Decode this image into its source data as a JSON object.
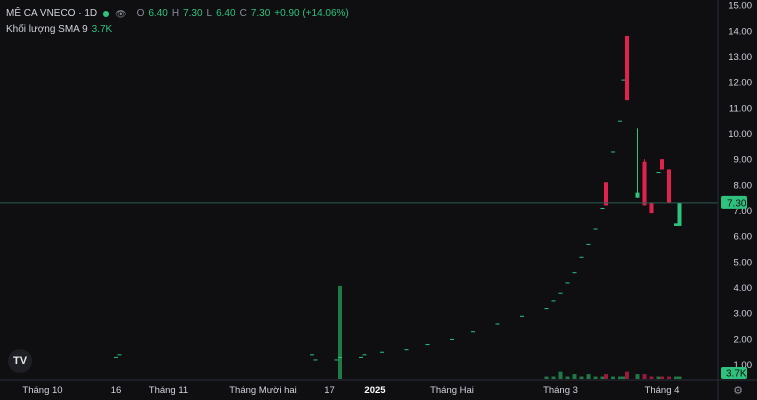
{
  "header": {
    "symbol": "MÊ CA VNECO · 1D",
    "ohlc": {
      "o_label": "O",
      "o": "6.40",
      "h_label": "H",
      "h": "7.30",
      "l_label": "L",
      "l": "6.40",
      "c_label": "C",
      "c": "7.30",
      "change": "+0.90 (+14.06%)"
    },
    "volume_label": "Khối lượng SMA 9",
    "volume_value": "3.7K"
  },
  "price_badge": "7.30",
  "volume_badge": "3.7K",
  "colors": {
    "up": "#2ec27e",
    "down": "#e0234e",
    "bg": "#0f0f12",
    "axis_text": "#d1d4dc",
    "price_line": "#2f5c55"
  },
  "icons": [
    "eye-icon",
    "more-icon",
    "tradingview-logo-icon",
    "settings-icon"
  ],
  "logo_text": "TV",
  "chart_data": {
    "type": "candlestick",
    "ylim": [
      0.4,
      15.2
    ],
    "y_ticks": [
      "1.00",
      "2.00",
      "3.00",
      "4.00",
      "5.00",
      "6.00",
      "7.00",
      "8.00",
      "9.00",
      "10.00",
      "11.00",
      "12.00",
      "13.00",
      "14.00",
      "15.00"
    ],
    "x_labels": [
      {
        "label": "Tháng 10",
        "index": 9
      },
      {
        "label": "16",
        "index": 30
      },
      {
        "label": "Tháng 11",
        "index": 45
      },
      {
        "label": "Tháng Mười hai",
        "index": 72
      },
      {
        "label": "17",
        "index": 91
      },
      {
        "label": "2025",
        "index": 104
      },
      {
        "label": "Tháng Hai",
        "index": 126
      },
      {
        "label": "Tháng 3",
        "index": 157
      },
      {
        "label": "Tháng 4",
        "index": 186
      }
    ],
    "last_close": 7.3,
    "candles": [
      {
        "i": 0,
        "o": 1.3,
        "h": 1.3,
        "l": 1.3,
        "c": 1.3,
        "v": 0
      },
      {
        "i": 30,
        "o": 1.3,
        "h": 1.3,
        "l": 1.3,
        "c": 1.3,
        "v": 0
      },
      {
        "i": 31,
        "o": 1.4,
        "h": 1.4,
        "l": 1.4,
        "c": 1.4,
        "v": 0
      },
      {
        "i": 86,
        "o": 1.4,
        "h": 1.4,
        "l": 1.4,
        "c": 1.4,
        "v": 0
      },
      {
        "i": 87,
        "o": 1.2,
        "h": 1.2,
        "l": 1.2,
        "c": 1.2,
        "v": 0
      },
      {
        "i": 93,
        "o": 1.2,
        "h": 1.2,
        "l": 1.2,
        "c": 1.2,
        "v": 0
      },
      {
        "i": 94,
        "o": 1.3,
        "h": 1.3,
        "l": 1.3,
        "c": 1.3,
        "v": 38
      },
      {
        "i": 100,
        "o": 1.3,
        "h": 1.3,
        "l": 1.3,
        "c": 1.3,
        "v": 0
      },
      {
        "i": 101,
        "o": 1.4,
        "h": 1.4,
        "l": 1.4,
        "c": 1.4,
        "v": 0
      },
      {
        "i": 106,
        "o": 1.5,
        "h": 1.5,
        "l": 1.5,
        "c": 1.5,
        "v": 0
      },
      {
        "i": 113,
        "o": 1.6,
        "h": 1.6,
        "l": 1.6,
        "c": 1.6,
        "v": 0
      },
      {
        "i": 119,
        "o": 1.8,
        "h": 1.8,
        "l": 1.8,
        "c": 1.8,
        "v": 0
      },
      {
        "i": 126,
        "o": 2.0,
        "h": 2.0,
        "l": 2.0,
        "c": 2.0,
        "v": 0
      },
      {
        "i": 132,
        "o": 2.3,
        "h": 2.3,
        "l": 2.3,
        "c": 2.3,
        "v": 0
      },
      {
        "i": 139,
        "o": 2.6,
        "h": 2.6,
        "l": 2.6,
        "c": 2.6,
        "v": 0
      },
      {
        "i": 146,
        "o": 2.9,
        "h": 2.9,
        "l": 2.9,
        "c": 2.9,
        "v": 0
      },
      {
        "i": 153,
        "o": 3.2,
        "h": 3.2,
        "l": 3.2,
        "c": 3.2,
        "v": 1
      },
      {
        "i": 155,
        "o": 3.5,
        "h": 3.5,
        "l": 3.5,
        "c": 3.5,
        "v": 1
      },
      {
        "i": 157,
        "o": 3.8,
        "h": 3.8,
        "l": 3.8,
        "c": 3.8,
        "v": 3
      },
      {
        "i": 159,
        "o": 4.2,
        "h": 4.2,
        "l": 4.2,
        "c": 4.2,
        "v": 1
      },
      {
        "i": 161,
        "o": 4.6,
        "h": 4.6,
        "l": 4.6,
        "c": 4.6,
        "v": 2
      },
      {
        "i": 163,
        "o": 5.2,
        "h": 5.2,
        "l": 5.2,
        "c": 5.2,
        "v": 1
      },
      {
        "i": 165,
        "o": 5.7,
        "h": 5.7,
        "l": 5.7,
        "c": 5.7,
        "v": 2
      },
      {
        "i": 167,
        "o": 6.3,
        "h": 6.3,
        "l": 6.3,
        "c": 6.3,
        "v": 1
      },
      {
        "i": 169,
        "o": 7.1,
        "h": 7.1,
        "l": 7.1,
        "c": 7.1,
        "v": 1
      },
      {
        "i": 170,
        "o": 8.1,
        "h": 8.1,
        "l": 7.2,
        "c": 7.2,
        "v": 2
      },
      {
        "i": 172,
        "o": 9.3,
        "h": 9.3,
        "l": 9.3,
        "c": 9.3,
        "v": 1
      },
      {
        "i": 174,
        "o": 10.5,
        "h": 10.5,
        "l": 10.5,
        "c": 10.5,
        "v": 1
      },
      {
        "i": 175,
        "o": 12.1,
        "h": 12.1,
        "l": 12.1,
        "c": 12.1,
        "v": 1
      },
      {
        "i": 176,
        "o": 13.8,
        "h": 13.8,
        "l": 11.3,
        "c": 11.3,
        "v": 3
      },
      {
        "i": 179,
        "o": 7.5,
        "h": 10.2,
        "l": 7.5,
        "c": 7.7,
        "v": 2
      },
      {
        "i": 181,
        "o": 8.9,
        "h": 9.0,
        "l": 7.2,
        "c": 7.2,
        "v": 2
      },
      {
        "i": 183,
        "o": 7.3,
        "h": 7.3,
        "l": 6.9,
        "c": 6.9,
        "v": 1
      },
      {
        "i": 185,
        "o": 8.5,
        "h": 8.5,
        "l": 8.5,
        "c": 8.5,
        "v": 1
      },
      {
        "i": 186,
        "o": 9.0,
        "h": 9.0,
        "l": 8.6,
        "c": 8.6,
        "v": 1
      },
      {
        "i": 188,
        "o": 8.6,
        "h": 8.6,
        "l": 7.3,
        "c": 7.3,
        "v": 1
      },
      {
        "i": 190,
        "o": 6.4,
        "h": 6.5,
        "l": 6.4,
        "c": 6.5,
        "v": 1
      },
      {
        "i": 191,
        "o": 6.4,
        "h": 7.3,
        "l": 6.4,
        "c": 7.3,
        "v": 1
      }
    ]
  }
}
